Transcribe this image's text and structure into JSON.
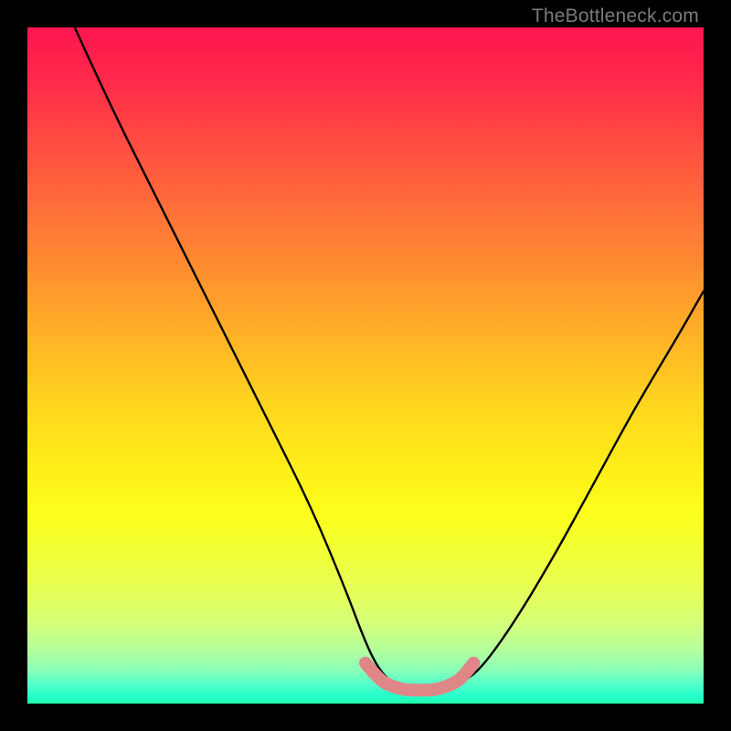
{
  "watermark": "TheBottleneck.com",
  "chart_data": {
    "type": "line",
    "title": "",
    "xlabel": "",
    "ylabel": "",
    "xlim": [
      0,
      100
    ],
    "ylim": [
      0,
      100
    ],
    "series": [
      {
        "name": "curve",
        "color": "#000000",
        "x": [
          7,
          12,
          18,
          24,
          30,
          36,
          42,
          47,
          50,
          52,
          54,
          56,
          58,
          60,
          62,
          64,
          67,
          72,
          78,
          84,
          90,
          96,
          100
        ],
        "y": [
          100,
          89,
          77,
          65,
          53,
          41,
          29,
          17,
          9,
          5,
          3,
          2,
          2,
          2,
          2,
          3,
          5,
          12,
          22,
          33,
          44,
          54,
          61
        ]
      },
      {
        "name": "highlight",
        "color": "#e08080",
        "x": [
          50,
          52,
          54,
          56,
          58,
          60,
          62,
          64,
          66
        ],
        "y": [
          6,
          3.5,
          2.5,
          2,
          2,
          2,
          2.5,
          3.5,
          6
        ]
      }
    ],
    "background_gradient": {
      "top": "#ff1550",
      "mid": "#ffd61e",
      "bottom": "#23ffa8"
    }
  }
}
